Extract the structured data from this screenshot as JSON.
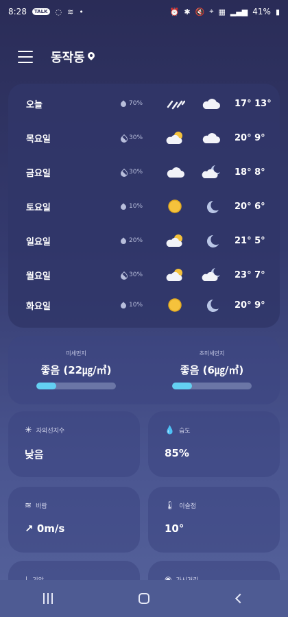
{
  "status_bar": {
    "time": "8:28",
    "chat_badge": "TALK",
    "battery": "41%"
  },
  "header": {
    "location": "동작동"
  },
  "forecast": [
    {
      "day": "오늘",
      "rain": "70%",
      "day_icon": "rain-icon",
      "night_icon": "cloud-icon",
      "high": "17°",
      "low": "13°"
    },
    {
      "day": "목요일",
      "rain": "30%",
      "day_icon": "partly-sunny-icon",
      "night_icon": "cloud-icon",
      "high": "20°",
      "low": "9°"
    },
    {
      "day": "금요일",
      "rain": "30%",
      "day_icon": "cloud-icon",
      "night_icon": "partly-cloudy-night-icon",
      "high": "18°",
      "low": "8°"
    },
    {
      "day": "토요일",
      "rain": "10%",
      "day_icon": "sun-icon",
      "night_icon": "moon-icon",
      "high": "20°",
      "low": "6°"
    },
    {
      "day": "일요일",
      "rain": "20%",
      "day_icon": "partly-sunny-icon",
      "night_icon": "moon-icon",
      "high": "21°",
      "low": "5°"
    },
    {
      "day": "월요일",
      "rain": "30%",
      "day_icon": "partly-sunny-icon",
      "night_icon": "partly-cloudy-night-icon",
      "high": "23°",
      "low": "7°"
    },
    {
      "day": "화요일",
      "rain": "10%",
      "day_icon": "sun-icon",
      "night_icon": "moon-icon",
      "high": "20°",
      "low": "9°"
    }
  ],
  "dust": {
    "pm10": {
      "label": "미세먼지",
      "value": "좋음 (22㎍/㎥)",
      "level": 0.25
    },
    "pm25": {
      "label": "초미세먼지",
      "value": "좋음 (6㎍/㎥)",
      "level": 0.25
    }
  },
  "tiles": {
    "uv": {
      "label": "자외선지수",
      "value": "낮음"
    },
    "humidity": {
      "label": "습도",
      "value": "85%"
    },
    "wind": {
      "label": "바람",
      "value": "0m/s"
    },
    "dew": {
      "label": "이슬점",
      "value": "10°"
    },
    "pressure": {
      "label": "기압"
    },
    "visibility": {
      "label": "가시거리"
    }
  },
  "colors": {
    "accent": "#63d0f2",
    "sun": "#f5c23c",
    "moon": "#b9c6e6"
  }
}
